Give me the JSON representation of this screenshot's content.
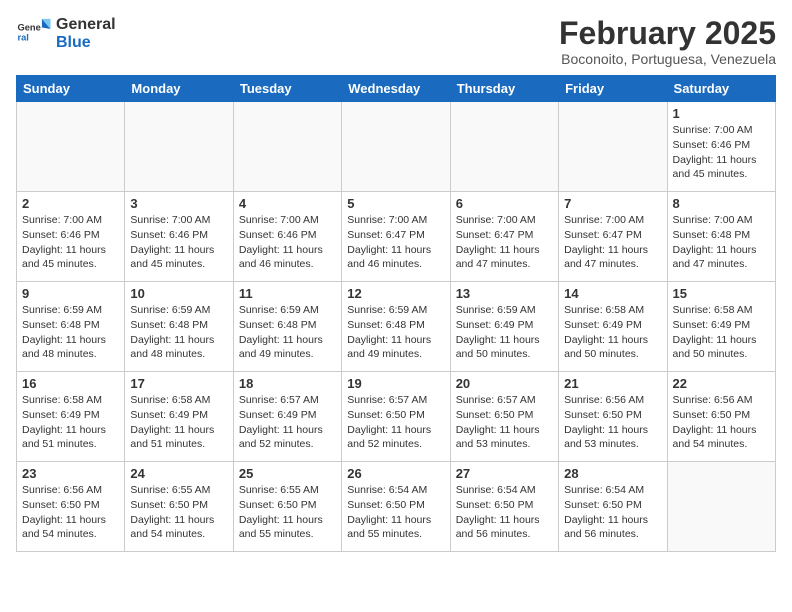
{
  "header": {
    "logo_general": "General",
    "logo_blue": "Blue",
    "title": "February 2025",
    "subtitle": "Boconoito, Portuguesa, Venezuela"
  },
  "calendar": {
    "days_of_week": [
      "Sunday",
      "Monday",
      "Tuesday",
      "Wednesday",
      "Thursday",
      "Friday",
      "Saturday"
    ],
    "weeks": [
      [
        {
          "day": "",
          "info": ""
        },
        {
          "day": "",
          "info": ""
        },
        {
          "day": "",
          "info": ""
        },
        {
          "day": "",
          "info": ""
        },
        {
          "day": "",
          "info": ""
        },
        {
          "day": "",
          "info": ""
        },
        {
          "day": "1",
          "info": "Sunrise: 7:00 AM\nSunset: 6:46 PM\nDaylight: 11 hours and 45 minutes."
        }
      ],
      [
        {
          "day": "2",
          "info": "Sunrise: 7:00 AM\nSunset: 6:46 PM\nDaylight: 11 hours and 45 minutes."
        },
        {
          "day": "3",
          "info": "Sunrise: 7:00 AM\nSunset: 6:46 PM\nDaylight: 11 hours and 45 minutes."
        },
        {
          "day": "4",
          "info": "Sunrise: 7:00 AM\nSunset: 6:46 PM\nDaylight: 11 hours and 46 minutes."
        },
        {
          "day": "5",
          "info": "Sunrise: 7:00 AM\nSunset: 6:47 PM\nDaylight: 11 hours and 46 minutes."
        },
        {
          "day": "6",
          "info": "Sunrise: 7:00 AM\nSunset: 6:47 PM\nDaylight: 11 hours and 47 minutes."
        },
        {
          "day": "7",
          "info": "Sunrise: 7:00 AM\nSunset: 6:47 PM\nDaylight: 11 hours and 47 minutes."
        },
        {
          "day": "8",
          "info": "Sunrise: 7:00 AM\nSunset: 6:48 PM\nDaylight: 11 hours and 47 minutes."
        }
      ],
      [
        {
          "day": "9",
          "info": "Sunrise: 6:59 AM\nSunset: 6:48 PM\nDaylight: 11 hours and 48 minutes."
        },
        {
          "day": "10",
          "info": "Sunrise: 6:59 AM\nSunset: 6:48 PM\nDaylight: 11 hours and 48 minutes."
        },
        {
          "day": "11",
          "info": "Sunrise: 6:59 AM\nSunset: 6:48 PM\nDaylight: 11 hours and 49 minutes."
        },
        {
          "day": "12",
          "info": "Sunrise: 6:59 AM\nSunset: 6:48 PM\nDaylight: 11 hours and 49 minutes."
        },
        {
          "day": "13",
          "info": "Sunrise: 6:59 AM\nSunset: 6:49 PM\nDaylight: 11 hours and 50 minutes."
        },
        {
          "day": "14",
          "info": "Sunrise: 6:58 AM\nSunset: 6:49 PM\nDaylight: 11 hours and 50 minutes."
        },
        {
          "day": "15",
          "info": "Sunrise: 6:58 AM\nSunset: 6:49 PM\nDaylight: 11 hours and 50 minutes."
        }
      ],
      [
        {
          "day": "16",
          "info": "Sunrise: 6:58 AM\nSunset: 6:49 PM\nDaylight: 11 hours and 51 minutes."
        },
        {
          "day": "17",
          "info": "Sunrise: 6:58 AM\nSunset: 6:49 PM\nDaylight: 11 hours and 51 minutes."
        },
        {
          "day": "18",
          "info": "Sunrise: 6:57 AM\nSunset: 6:49 PM\nDaylight: 11 hours and 52 minutes."
        },
        {
          "day": "19",
          "info": "Sunrise: 6:57 AM\nSunset: 6:50 PM\nDaylight: 11 hours and 52 minutes."
        },
        {
          "day": "20",
          "info": "Sunrise: 6:57 AM\nSunset: 6:50 PM\nDaylight: 11 hours and 53 minutes."
        },
        {
          "day": "21",
          "info": "Sunrise: 6:56 AM\nSunset: 6:50 PM\nDaylight: 11 hours and 53 minutes."
        },
        {
          "day": "22",
          "info": "Sunrise: 6:56 AM\nSunset: 6:50 PM\nDaylight: 11 hours and 54 minutes."
        }
      ],
      [
        {
          "day": "23",
          "info": "Sunrise: 6:56 AM\nSunset: 6:50 PM\nDaylight: 11 hours and 54 minutes."
        },
        {
          "day": "24",
          "info": "Sunrise: 6:55 AM\nSunset: 6:50 PM\nDaylight: 11 hours and 54 minutes."
        },
        {
          "day": "25",
          "info": "Sunrise: 6:55 AM\nSunset: 6:50 PM\nDaylight: 11 hours and 55 minutes."
        },
        {
          "day": "26",
          "info": "Sunrise: 6:54 AM\nSunset: 6:50 PM\nDaylight: 11 hours and 55 minutes."
        },
        {
          "day": "27",
          "info": "Sunrise: 6:54 AM\nSunset: 6:50 PM\nDaylight: 11 hours and 56 minutes."
        },
        {
          "day": "28",
          "info": "Sunrise: 6:54 AM\nSunset: 6:50 PM\nDaylight: 11 hours and 56 minutes."
        },
        {
          "day": "",
          "info": ""
        }
      ]
    ]
  }
}
